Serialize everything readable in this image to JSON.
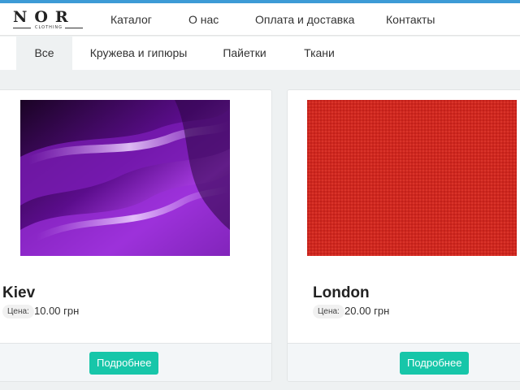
{
  "brand": {
    "name": "NOR",
    "tagline": "CLOTHING"
  },
  "nav": {
    "items": [
      {
        "label": "Каталог"
      },
      {
        "label": "О нас"
      },
      {
        "label": "Оплата и доставка"
      },
      {
        "label": "Контакты"
      }
    ]
  },
  "tabs": {
    "active": "Все",
    "items": [
      {
        "label": "Все"
      },
      {
        "label": "Кружева и гипюры"
      },
      {
        "label": "Пайетки"
      },
      {
        "label": "Ткани"
      }
    ]
  },
  "products": [
    {
      "title": "Kiev",
      "price_label": "Цена:",
      "price": "10.00 грн",
      "image": "purple-satin-fabric",
      "button": "Подробнее"
    },
    {
      "title": "London",
      "price_label": "Цена:",
      "price": "20.00 грн",
      "image": "red-linen-fabric",
      "button": "Подробнее"
    }
  ],
  "colors": {
    "accent_top": "#3d9bd6",
    "button": "#17c6a9",
    "background": "#eef1f2"
  }
}
